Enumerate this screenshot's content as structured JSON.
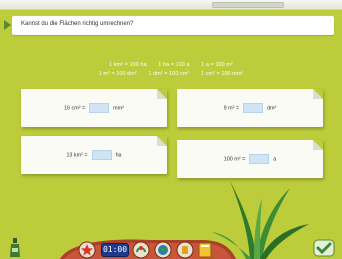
{
  "question": "Kannst du die Flächen richtig umrechnen?",
  "formulas": {
    "row1": [
      "1 km² = 100 ha",
      "1 ha = 100 a",
      "1 a = 100 m²"
    ],
    "row2": [
      "1 m² = 100 dm²",
      "1 dm² = 100 cm²",
      "1 cm² = 100 mm²"
    ]
  },
  "tasks": [
    {
      "left": "16 cm² =",
      "right": "mm²"
    },
    {
      "left": "9 m² =",
      "right": "dm²"
    },
    {
      "left": "13 km² =",
      "right": "ha"
    },
    {
      "left": "100 m² =",
      "right": "a"
    }
  ],
  "toolbar": {
    "clock": "01:00"
  }
}
